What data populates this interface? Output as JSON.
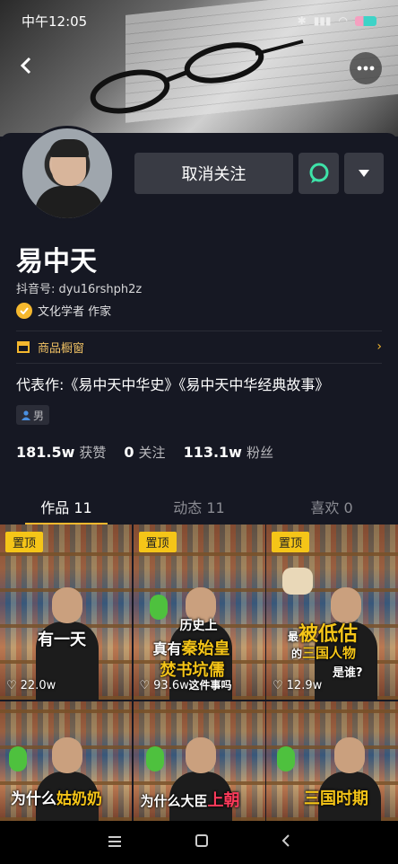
{
  "status_bar": {
    "time": "中午12:05"
  },
  "profile": {
    "follow_button": "取消关注",
    "name": "易中天",
    "douyin_id": "抖音号: dyu16rshph2z",
    "verification": "文化学者 作家",
    "shop_window": "商品橱窗",
    "signature": "代表作:《易中天中华史》《易中天中华经典故事》",
    "gender": "男",
    "stats": [
      {
        "num": "181.5w",
        "label": "获赞"
      },
      {
        "num": "0",
        "label": "关注"
      },
      {
        "num": "113.1w",
        "label": "粉丝"
      }
    ]
  },
  "tabs": [
    {
      "label": "作品 11",
      "active": true
    },
    {
      "label": "动态 11",
      "active": false
    },
    {
      "label": "喜欢 0",
      "active": false
    }
  ],
  "videos": [
    {
      "pinned": "置顶",
      "likes": "22.0w",
      "caption": "有一天"
    },
    {
      "pinned": "置顶",
      "likes": "93.6w",
      "caption_line1": "历史上",
      "caption_line2a": "真有",
      "caption_line2b": "秦始皇",
      "caption_line3": "焚书坑儒",
      "caption_line4": "这件事吗"
    },
    {
      "pinned": "置顶",
      "likes": "12.9w",
      "caption_pre": "最",
      "caption_hl": "被低估",
      "caption_line2a": "的",
      "caption_line2b": "三国人物",
      "caption_line3": "是谁?"
    },
    {
      "caption_a": "为什么",
      "caption_b": "姑奶奶"
    },
    {
      "caption_a": "为什么大臣",
      "caption_b": "上朝"
    },
    {
      "caption_a": "三国时期"
    }
  ],
  "colors": {
    "background": "#161823",
    "accent": "#f5b82e",
    "button": "#393b44"
  }
}
